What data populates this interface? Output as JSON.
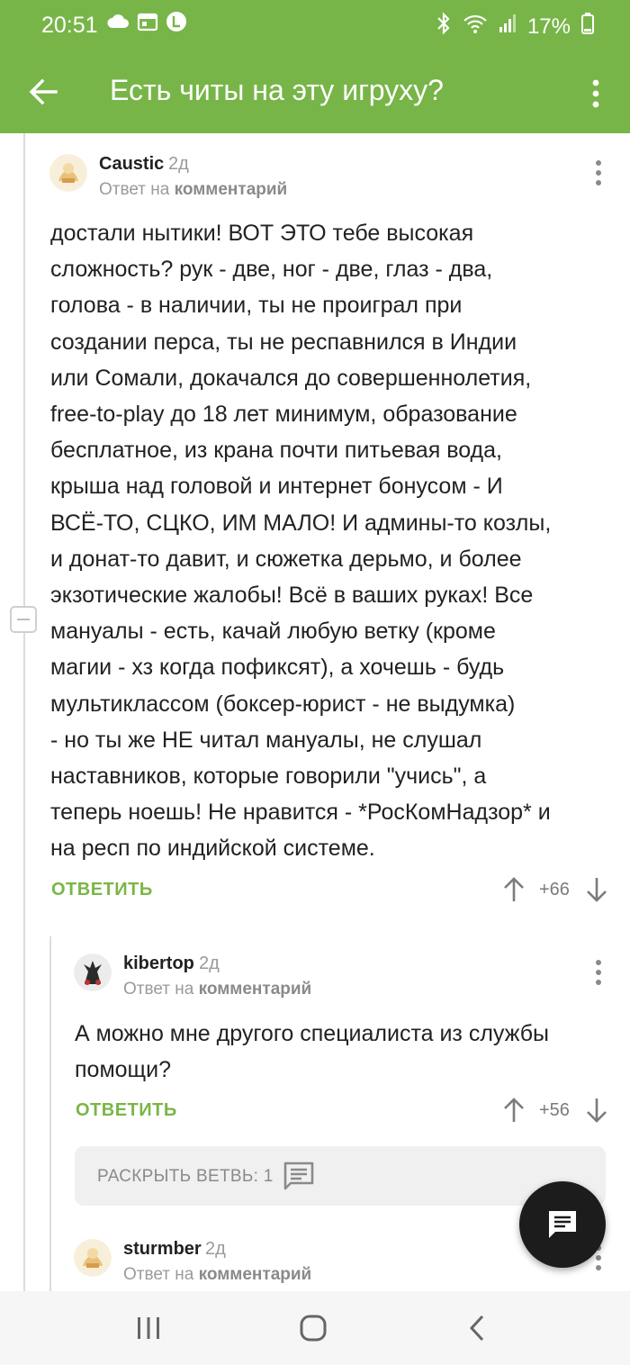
{
  "status_bar": {
    "time": "20:51",
    "battery": "17%",
    "icons": [
      "cloud-icon",
      "calendar-icon",
      "notification-l-icon",
      "bluetooth-icon",
      "wifi-icon",
      "signal-icon",
      "battery-icon"
    ]
  },
  "app_bar": {
    "title": "Есть читы на эту игруху?",
    "back_icon": "arrow-back-icon",
    "menu_icon": "more-vert-icon"
  },
  "colors": {
    "accent": "#78b548",
    "reply_link": "#7ab648"
  },
  "comments": [
    {
      "username": "Caustic",
      "ago": "2д",
      "reply_prefix": "Ответ на",
      "reply_target": "комментарий",
      "text": "достали нытики! ВОТ ЭТО тебе высокая\nсложность? рук - две, ног - две, глаз - два,\nголова - в наличии, ты не проиграл при\nсоздании перса, ты не респавнился в Индии\nили Сомали, докачался до совершеннолетия,\nfree-to-play до 18 лет минимум, образование\nбесплатное, из крана почти питьевая вода,\nкрыша над головой и интернет бонусом - И\nВСЁ-ТО, СЦКО, ИМ МАЛО! И админы-то козлы,\nи донат-то давит, и сюжетка дерьмо, и более\nэкзотические жалобы! Всё в ваших руках! Все\nмануалы - есть, качай любую ветку (кроме\nмагии - хз когда пофиксят), а хочешь - будь\nмультиклассом (боксер-юрист - не выдумка)\n- но ты же НЕ читал мануалы, не слушал\nнаставников, которые говорили \"учись\", а\nтеперь ноешь! Не нравится - *РосКомНадзор* и\nна респ по индийской системе.",
      "reply_label": "ОТВЕТИТЬ",
      "score": "+66"
    },
    {
      "username": "kibertop",
      "ago": "2д",
      "reply_prefix": "Ответ на",
      "reply_target": "комментарий",
      "text": "А можно мне другого специалиста из службы\nпомощи?",
      "reply_label": "ОТВЕТИТЬ",
      "score": "+56"
    },
    {
      "username": "sturmber",
      "ago": "2д",
      "reply_prefix": "Ответ на",
      "reply_target": "комментарий"
    }
  ],
  "expand_branch": {
    "label": "РАСКРЫТЬ ВЕТВЬ: 1"
  },
  "fab_icon": "comment-icon",
  "nav_bar": [
    "recents-icon",
    "home-icon",
    "back-icon"
  ]
}
